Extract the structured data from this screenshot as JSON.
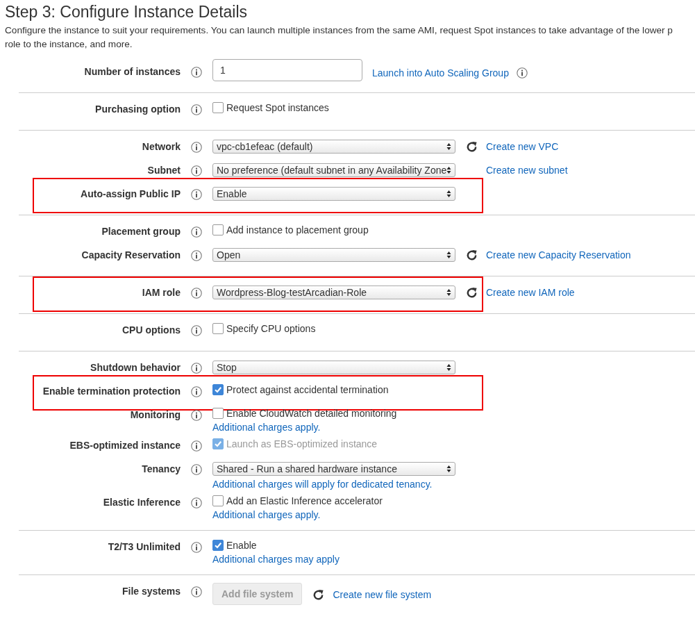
{
  "title": "Step 3: Configure Instance Details",
  "description_lines": [
    "Configure the instance to suit your requirements. You can launch multiple instances from the same AMI, request Spot instances to take advantage of the lower p",
    "role to the instance, and more."
  ],
  "sections": [
    {
      "rows": [
        {
          "label": "Number of instances",
          "highlighted": false,
          "control": {
            "kind": "input",
            "value": "1"
          },
          "link": "Launch into Auto Scaling Group",
          "link_info": true,
          "refresh": false
        }
      ]
    },
    {
      "rows": [
        {
          "label": "Purchasing option",
          "highlighted": false,
          "control": {
            "kind": "checkbox",
            "text": "Request Spot instances",
            "checked": false,
            "disabled": false
          },
          "refresh": false
        }
      ]
    },
    {
      "rows": [
        {
          "label": "Network",
          "highlighted": false,
          "control": {
            "kind": "select",
            "value": "vpc-cb1efeac (default)"
          },
          "refresh": true,
          "link": "Create new VPC"
        },
        {
          "label": "Subnet",
          "highlighted": false,
          "control": {
            "kind": "select",
            "value": "No preference (default subnet in any Availability Zone"
          },
          "refresh": false,
          "link": "Create new subnet"
        },
        {
          "label": "Auto-assign Public IP",
          "highlighted": true,
          "control": {
            "kind": "select",
            "value": "Enable"
          },
          "refresh": false
        }
      ]
    },
    {
      "rows": [
        {
          "label": "Placement group",
          "highlighted": false,
          "control": {
            "kind": "checkbox",
            "text": "Add instance to placement group",
            "checked": false,
            "disabled": false
          },
          "refresh": false
        },
        {
          "label": "Capacity Reservation",
          "highlighted": false,
          "control": {
            "kind": "select",
            "value": "Open"
          },
          "refresh": true,
          "link": "Create new Capacity Reservation"
        }
      ]
    },
    {
      "rows": [
        {
          "label": "IAM role",
          "highlighted": true,
          "control": {
            "kind": "select",
            "value": "Wordpress-Blog-testArcadian-Role"
          },
          "refresh": true,
          "link": "Create new IAM role"
        }
      ]
    },
    {
      "rows": [
        {
          "label": "CPU options",
          "highlighted": false,
          "control": {
            "kind": "checkbox",
            "text": "Specify CPU options",
            "checked": false,
            "disabled": false
          },
          "refresh": false
        }
      ]
    },
    {
      "rows": [
        {
          "label": "Shutdown behavior",
          "highlighted": false,
          "control": {
            "kind": "select",
            "value": "Stop"
          },
          "refresh": false
        },
        {
          "label": "Enable termination protection",
          "highlighted": true,
          "control": {
            "kind": "checkbox",
            "text": "Protect against accidental termination",
            "checked": true,
            "disabled": false
          },
          "refresh": false
        },
        {
          "label": "Monitoring",
          "highlighted": false,
          "control": {
            "kind": "checkbox",
            "text": "Enable CloudWatch detailed monitoring",
            "checked": false,
            "disabled": false
          },
          "note": "Additional charges apply.",
          "refresh": false
        },
        {
          "label": "EBS-optimized instance",
          "highlighted": false,
          "control": {
            "kind": "checkbox",
            "text": "Launch as EBS-optimized instance",
            "checked": true,
            "disabled": true
          },
          "refresh": false
        },
        {
          "label": "Tenancy",
          "highlighted": false,
          "control": {
            "kind": "select",
            "value": "Shared - Run a shared hardware instance"
          },
          "note": "Additional charges will apply for dedicated tenancy.",
          "refresh": false
        },
        {
          "label": "Elastic Inference",
          "highlighted": false,
          "control": {
            "kind": "checkbox",
            "text": "Add an Elastic Inference accelerator",
            "checked": false,
            "disabled": false
          },
          "note": "Additional charges apply.",
          "refresh": false
        }
      ]
    },
    {
      "rows": [
        {
          "label": "T2/T3 Unlimited",
          "highlighted": false,
          "control": {
            "kind": "checkbox",
            "text": "Enable",
            "checked": true,
            "disabled": false
          },
          "note": "Additional charges may apply",
          "refresh": false
        }
      ]
    },
    {
      "rows": [
        {
          "label": "File systems",
          "highlighted": false,
          "control": {
            "kind": "button",
            "text": "Add file system",
            "disabled": true
          },
          "refresh": true,
          "link": "Create new file system"
        }
      ]
    }
  ]
}
